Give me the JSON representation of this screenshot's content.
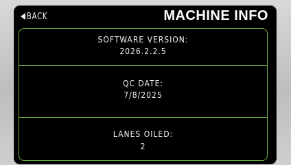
{
  "header": {
    "back_label": "BACK",
    "title": "MACHINE INFO"
  },
  "info": [
    {
      "label": "SOFTWARE VERSION:",
      "value": "2026.2.2.5"
    },
    {
      "label": "QC DATE:",
      "value": "7/8/2025"
    },
    {
      "label": "LANES OILED:",
      "value": "2"
    }
  ],
  "colors": {
    "screen_background": "#000000",
    "panel_border": "#6db33f",
    "text": "#f2f2f2",
    "bezel": "#c9c9c9"
  },
  "icons": {
    "back": "left-triangle-icon"
  }
}
